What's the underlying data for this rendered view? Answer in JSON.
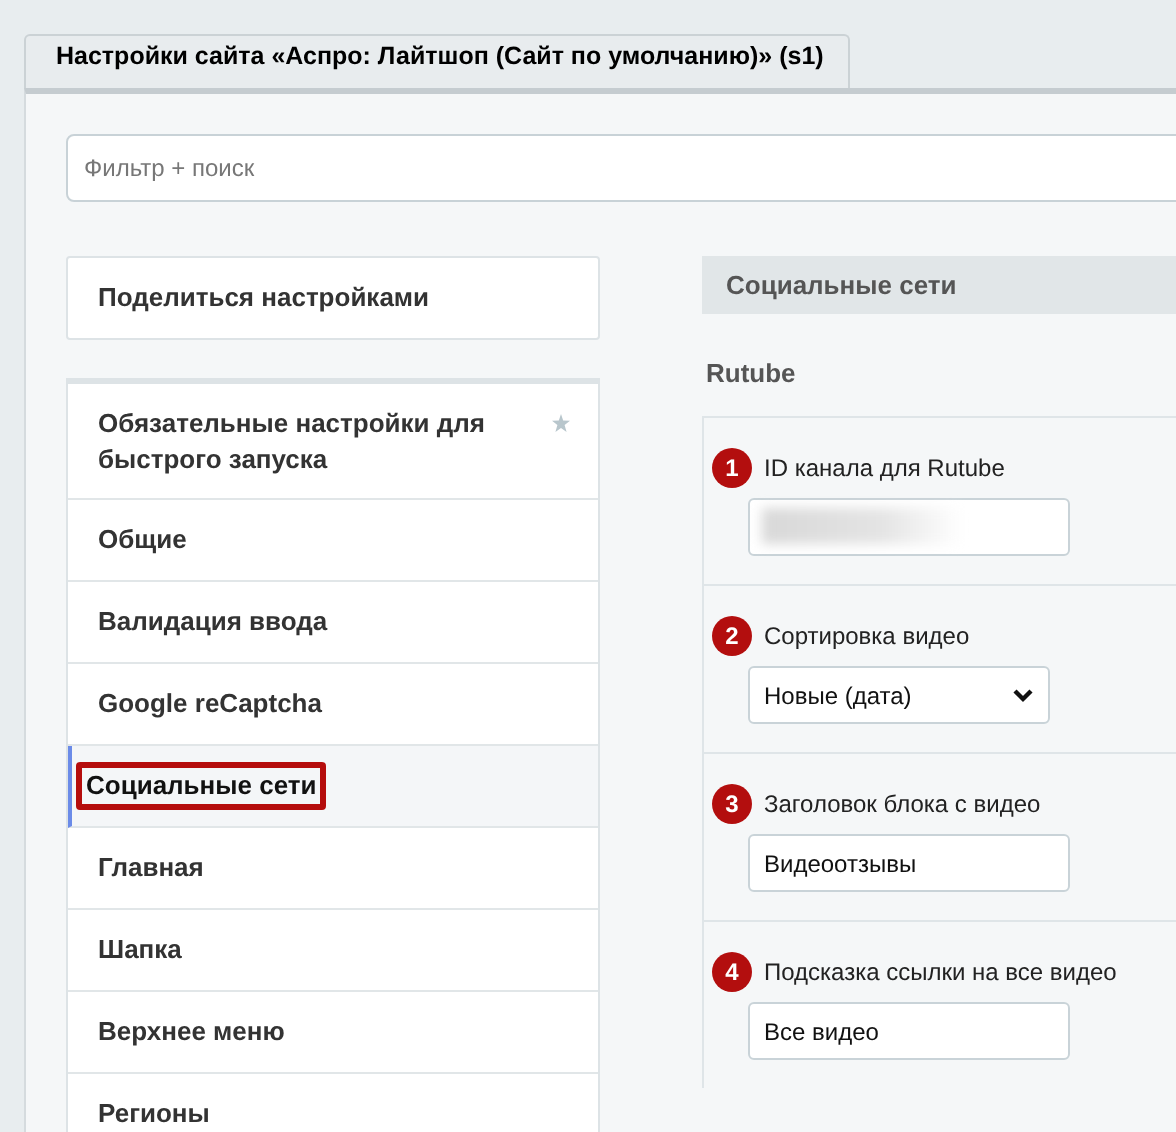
{
  "tabs": [
    {
      "label": "Настройки сайта «Аспро: Лайтшоп (Сайт по умолчанию)» (s1)",
      "selected": true
    }
  ],
  "filter": {
    "placeholder": "Фильтр + поиск"
  },
  "share_button": "Поделиться настройками",
  "sidebar": {
    "items": [
      {
        "label": "Обязательные настройки для быстрого запуска",
        "starred": true,
        "selected": false,
        "highlighted": false
      },
      {
        "label": "Общие",
        "starred": false,
        "selected": false,
        "highlighted": false
      },
      {
        "label": "Валидация ввода",
        "starred": false,
        "selected": false,
        "highlighted": false
      },
      {
        "label": "Google reCaptcha",
        "starred": false,
        "selected": false,
        "highlighted": false
      },
      {
        "label": "Социальные сети",
        "starred": false,
        "selected": true,
        "highlighted": true
      },
      {
        "label": "Главная",
        "starred": false,
        "selected": false,
        "highlighted": false
      },
      {
        "label": "Шапка",
        "starred": false,
        "selected": false,
        "highlighted": false
      },
      {
        "label": "Верхнее меню",
        "starred": false,
        "selected": false,
        "highlighted": false
      },
      {
        "label": "Регионы",
        "starred": false,
        "selected": false,
        "highlighted": false
      }
    ]
  },
  "section": {
    "title": "Социальные сети",
    "subtitle": "Rutube",
    "fields": [
      {
        "badge": "1",
        "label": "ID канала для Rutube",
        "kind": "text",
        "redacted": true
      },
      {
        "badge": "2",
        "label": "Сортировка видео",
        "kind": "select",
        "value": "Новые (дата)"
      },
      {
        "badge": "3",
        "label": "Заголовок блока с видео",
        "kind": "text",
        "value": "Видеоотзывы"
      },
      {
        "badge": "4",
        "label": "Подсказка ссылки на все видео",
        "kind": "text",
        "value": "Все видео"
      }
    ]
  }
}
